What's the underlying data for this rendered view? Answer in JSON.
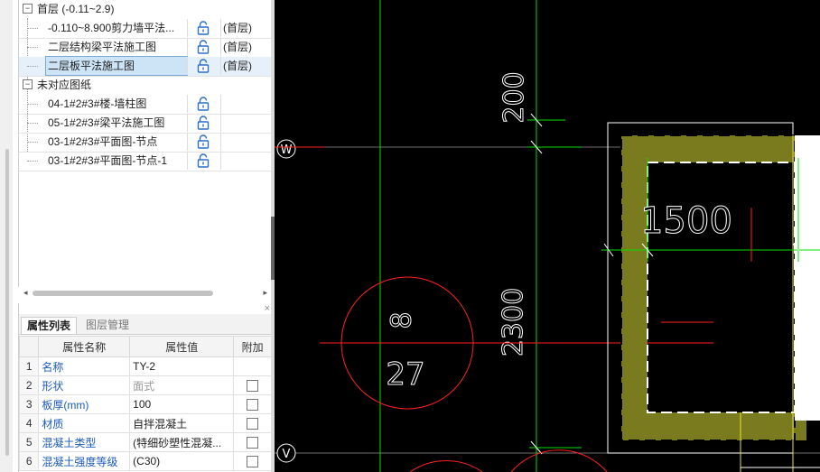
{
  "tree": {
    "groups": [
      {
        "label": "首层 (-0.11~2.9)",
        "toggle": "−"
      },
      {
        "label": "未对应图纸",
        "toggle": "−"
      }
    ],
    "items": [
      {
        "name": "-0.110~8.900剪力墙平法...",
        "floor": "(首层)"
      },
      {
        "name": "二层结构梁平法施工图",
        "floor": "(首层)"
      },
      {
        "name": "二层板平法施工图",
        "floor": "(首层)"
      },
      {
        "name": "04-1#2#3#楼-墙柱图",
        "floor": ""
      },
      {
        "name": "05-1#2#3#梁平法施工图",
        "floor": ""
      },
      {
        "name": "03-1#2#3#平面图-节点",
        "floor": ""
      },
      {
        "name": "03-1#2#3#平面图-节点-1",
        "floor": ""
      }
    ]
  },
  "scroll": {
    "left": "◂",
    "right": "▸"
  },
  "props_panel": {
    "close": "×",
    "tabs": [
      "属性列表",
      "图层管理"
    ],
    "headers": [
      "",
      "属性名称",
      "属性值",
      "附加"
    ],
    "rows": [
      {
        "no": "1",
        "name": "名称",
        "value": "TY-2"
      },
      {
        "no": "2",
        "name": "形状",
        "value": "面式"
      },
      {
        "no": "3",
        "name": "板厚(mm)",
        "value": "100"
      },
      {
        "no": "4",
        "name": "材质",
        "value": "自拌混凝土"
      },
      {
        "no": "5",
        "name": "混凝土类型",
        "value": "(特细砂塑性混凝..."
      },
      {
        "no": "6",
        "name": "混凝土强度等级",
        "value": "(C30)"
      }
    ]
  },
  "cad": {
    "axis_w": "W",
    "axis_v": "V",
    "dim_200": "200",
    "dim_2300": "2300",
    "dim_1500": "1500",
    "tag_8": "8",
    "tag_27": "27",
    "colors": {
      "green": "#00e000",
      "red": "#ff2020",
      "olive": "#7a7a1e",
      "white": "#ffffff",
      "yellow": "#e8e820"
    }
  }
}
